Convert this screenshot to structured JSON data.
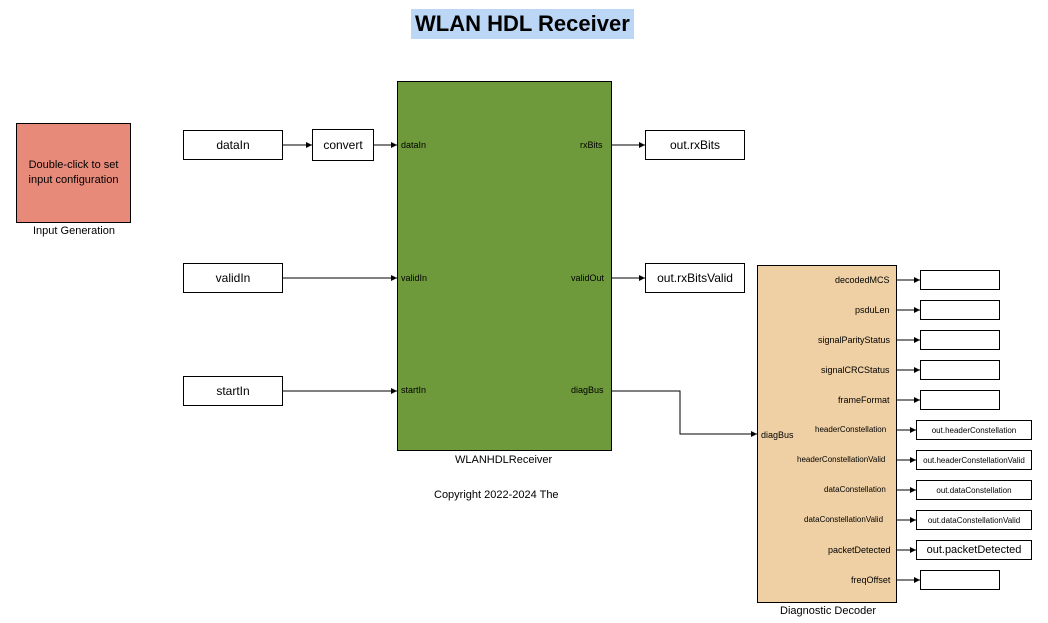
{
  "title": "WLAN HDL Receiver",
  "copyright": "Copyright 2022-2024 The",
  "input_gen": {
    "text": "Double-click to set\ninput configuration",
    "label": "Input Generation"
  },
  "from_blocks": {
    "dataIn": "dataIn",
    "validIn": "validIn",
    "startIn": "startIn"
  },
  "convert": "convert",
  "receiver": {
    "label": "WLANHDLReceiver",
    "in_ports": [
      "dataIn",
      "validIn",
      "startIn"
    ],
    "out_ports": [
      "rxBits",
      "validOut",
      "diagBus"
    ]
  },
  "goto_blocks": {
    "rxBits": "out.rxBits",
    "rxBitsValid": "out.rxBitsValid"
  },
  "diag": {
    "label": "Diagnostic Decoder",
    "in_port": "diagBus",
    "out_ports": [
      "decodedMCS",
      "psduLen",
      "signalParityStatus",
      "signalCRCStatus",
      "frameFormat",
      "headerConstellation",
      "headerConstellationValid",
      "dataConstellation",
      "dataConstellationValid",
      "packetDetected",
      "freqOffset"
    ]
  },
  "diag_sinks": [
    {
      "type": "display",
      "label": ""
    },
    {
      "type": "display",
      "label": ""
    },
    {
      "type": "display",
      "label": ""
    },
    {
      "type": "display",
      "label": ""
    },
    {
      "type": "display",
      "label": ""
    },
    {
      "type": "goto",
      "label": "out.headerConstellation"
    },
    {
      "type": "goto",
      "label": "out.headerConstellationValid"
    },
    {
      "type": "goto",
      "label": "out.dataConstellation"
    },
    {
      "type": "goto",
      "label": "out.dataConstellationValid"
    },
    {
      "type": "goto",
      "label": "out.packetDetected"
    },
    {
      "type": "display",
      "label": ""
    }
  ]
}
